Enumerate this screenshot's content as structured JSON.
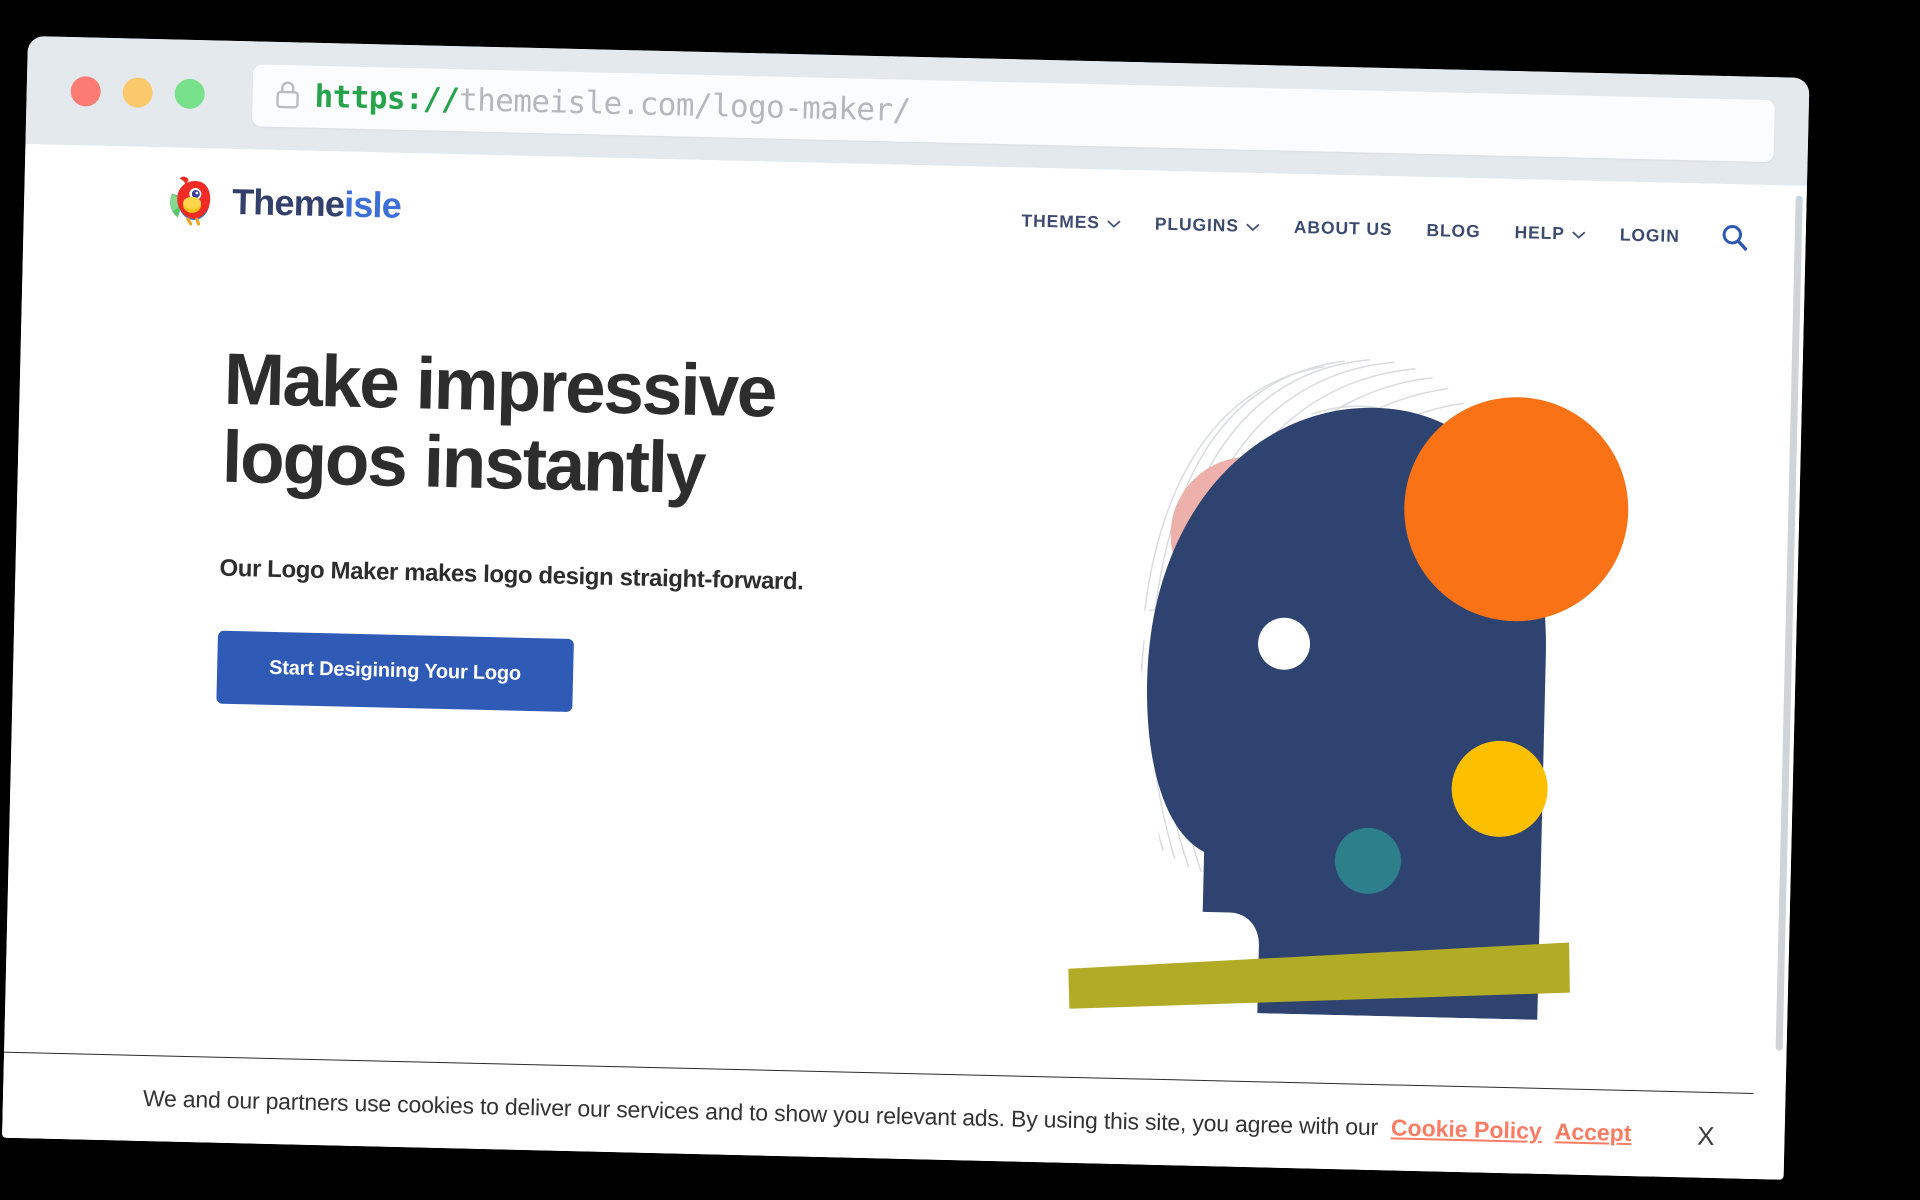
{
  "browser": {
    "traffic_lights": [
      "close",
      "minimize",
      "maximize"
    ],
    "lock_icon": "padlock-icon",
    "url_scheme": "https://",
    "url_rest": "themeisle.com/logo-maker/",
    "colors": {
      "titlebar": "#e4e9ed",
      "red": "#fc7b72",
      "yellow": "#fbc96b",
      "green": "#77e08a",
      "scheme_green": "#27a34b",
      "host_gray": "#b4b8bc"
    }
  },
  "site": {
    "brand": {
      "mark": "parrot-logo",
      "word_dark": "Theme",
      "word_blue": "isle",
      "color_dark": "#33406b",
      "color_blue": "#3d6fd6"
    },
    "nav": {
      "items": [
        {
          "label": "THEMES",
          "has_caret": true
        },
        {
          "label": "PLUGINS",
          "has_caret": true
        },
        {
          "label": "ABOUT US",
          "has_caret": false
        },
        {
          "label": "BLOG",
          "has_caret": false
        },
        {
          "label": "HELP",
          "has_caret": true
        },
        {
          "label": "LOGIN",
          "has_caret": false
        }
      ],
      "search_icon": "search-icon",
      "color": "#3d4a70"
    }
  },
  "hero": {
    "title_line1": "Make impressive",
    "title_line2": "logos instantly",
    "subtitle": "Our Logo Maker makes logo design straight-forward.",
    "cta_label": "Start Desigining Your Logo",
    "cta_color": "#2f5bb7",
    "illustration": {
      "name": "abstract-head-illustration",
      "head_color": "#2e4370",
      "orange_large": "#f97316",
      "orange_small": "#f97316",
      "pink_circle": "#eeb0ab",
      "yellow_circle": "#fcc000",
      "teal_circle": "#2e7f8c",
      "olive_bar": "#b2ab26",
      "eye_color": "#ffffff",
      "hair_lines": "#d8dade"
    }
  },
  "cookie_banner": {
    "message": "We and our partners use cookies to deliver our services and to show you relevant ads. By using this site, you agree with our",
    "policy_link": "Cookie Policy",
    "accept_link": "Accept",
    "close_label": "X",
    "link_color": "#fb7c64"
  }
}
